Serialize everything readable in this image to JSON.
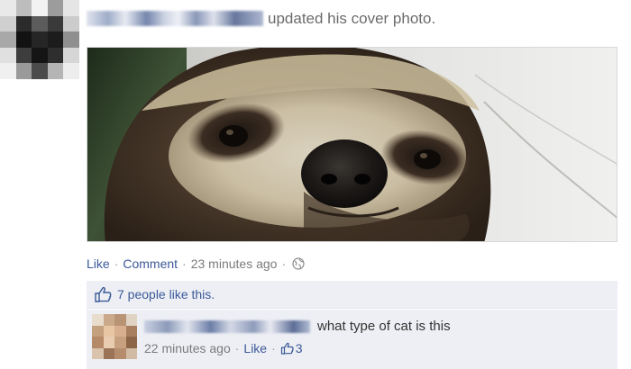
{
  "story": {
    "action_text": "updated his cover photo."
  },
  "post_actions": {
    "like": "Like",
    "comment": "Comment",
    "timestamp": "23 minutes ago",
    "separator": "·",
    "privacy_icon": "globe-icon"
  },
  "likes": {
    "icon": "thumbs-up-icon",
    "text": "7 people like this."
  },
  "comment": {
    "text": "what type of cat is this",
    "timestamp": "22 minutes ago",
    "like": "Like",
    "like_count": "3",
    "like_icon": "thumbs-up-icon"
  },
  "colors": {
    "link": "#3b5998",
    "muted": "#7b7b7b",
    "comment_bg": "#edeff4"
  }
}
